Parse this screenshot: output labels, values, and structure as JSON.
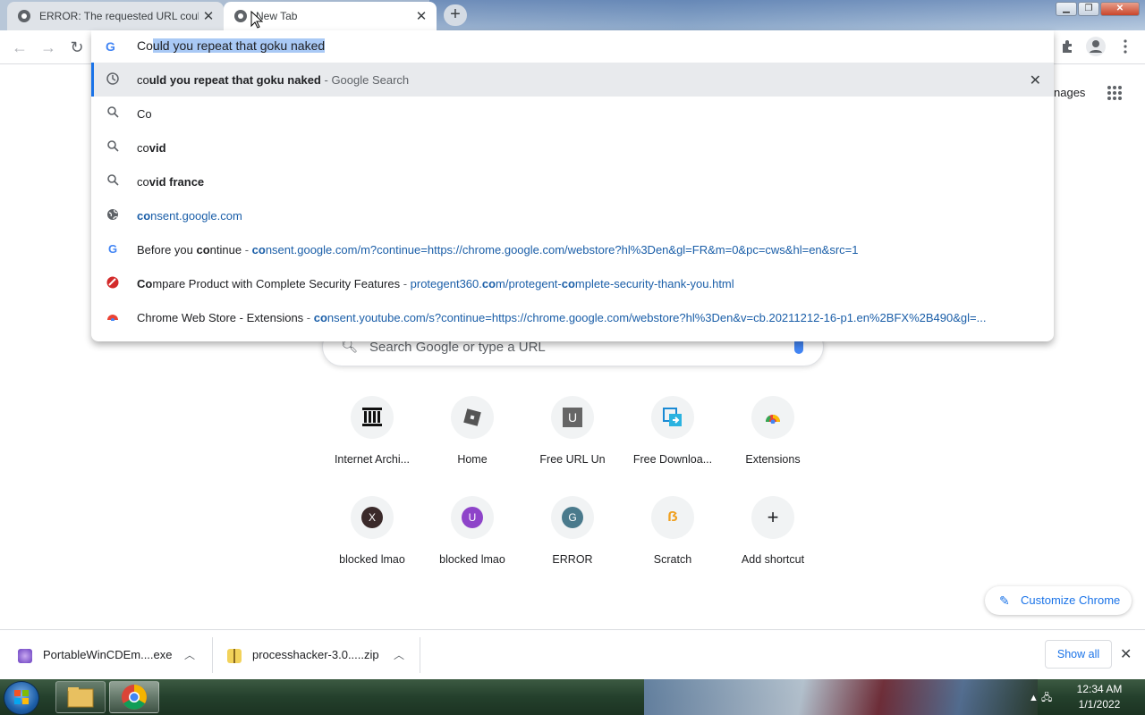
{
  "tabs": [
    {
      "title": "ERROR: The requested URL could",
      "close": "✕"
    },
    {
      "title": "New Tab",
      "close": "✕"
    }
  ],
  "new_tab_symbol": "+",
  "window_controls": {
    "minimize": "▁",
    "maximize": "❐",
    "close": "✕"
  },
  "nav": {
    "back": "←",
    "forward": "→",
    "reload": "↻"
  },
  "omnibox": {
    "typed_prefix": "Co",
    "selected_autocomplete": "uld you repeat that goku naked",
    "suggestions": [
      {
        "icon": "history-icon",
        "prefix": "co",
        "bold": "uld you repeat that goku naked",
        "sep": " - ",
        "source": "Google Search",
        "remove": "✕"
      },
      {
        "icon": "search-icon",
        "prefix": "Co",
        "bold": ""
      },
      {
        "icon": "search-icon",
        "prefix": "co",
        "bold": "vid"
      },
      {
        "icon": "search-icon",
        "prefix": "co",
        "bold": "vid france"
      },
      {
        "icon": "globe-icon",
        "url_hl": "co",
        "url_rest": "nsent.google.com"
      },
      {
        "icon": "google-icon",
        "title_pre": "Before you ",
        "title_hl": "co",
        "title_post": "ntinue",
        "sep": " - ",
        "url_hl": "co",
        "url_rest": "nsent.google.com/m?continue=https://chrome.google.com/webstore?hl%3Den&gl=FR&m=0&pc=cws&hl=en&src=1"
      },
      {
        "icon": "protegent-icon",
        "title_hl": "Co",
        "title_post": "mpare Product with Complete Security Features",
        "sep": " - ",
        "url_pre": "protegent360.",
        "url_hl": "co",
        "url_mid": "m/protegent-",
        "url_hl2": "co",
        "url_rest": "mplete-security-thank-you.html"
      },
      {
        "icon": "chrome-store-icon",
        "title_pre": "Chrome Web Store - Extensions",
        "sep": " - ",
        "url_hl": "co",
        "url_rest": "nsent.youtube.com/s?continue=https://chrome.google.com/webstore?hl%3Den&v=cb.20211212-16-p1.en%2BFX%2B490&gl=..."
      }
    ]
  },
  "header_links": {
    "images": "nages"
  },
  "search": {
    "placeholder": "Search Google or type a URL"
  },
  "shortcuts": [
    {
      "label": "Internet Archi...",
      "letter": ""
    },
    {
      "label": "Home",
      "letter": ""
    },
    {
      "label": "Free URL Un",
      "letter": "U"
    },
    {
      "label": "Free Downloa...",
      "letter": ""
    },
    {
      "label": "Extensions",
      "letter": ""
    },
    {
      "label": "blocked lmao",
      "letter": "X",
      "color": "#3a2a2a"
    },
    {
      "label": "blocked lmao",
      "letter": "U",
      "color": "#8e44c9"
    },
    {
      "label": "ERROR",
      "letter": "G",
      "color": "#4a7a8c"
    },
    {
      "label": "Scratch",
      "letter": "ẞ",
      "color": "#f0a020"
    },
    {
      "label": "Add shortcut",
      "letter": "+"
    }
  ],
  "customize": {
    "label": "Customize Chrome",
    "icon": "✎"
  },
  "downloads": [
    {
      "name": "PortableWinCDEm....exe",
      "chev": "︿"
    },
    {
      "name": "processhacker-3.0.....zip",
      "chev": "︿"
    }
  ],
  "downloads_bar": {
    "show_all": "Show all",
    "close": "✕"
  },
  "taskbar": {
    "time": "12:34 AM",
    "date": "1/1/2022"
  },
  "colors": {
    "accent": "#1a73e8",
    "url": "#1a5ea8",
    "highlight_row": "#e8eaed",
    "selection": "#a9c9f5"
  }
}
